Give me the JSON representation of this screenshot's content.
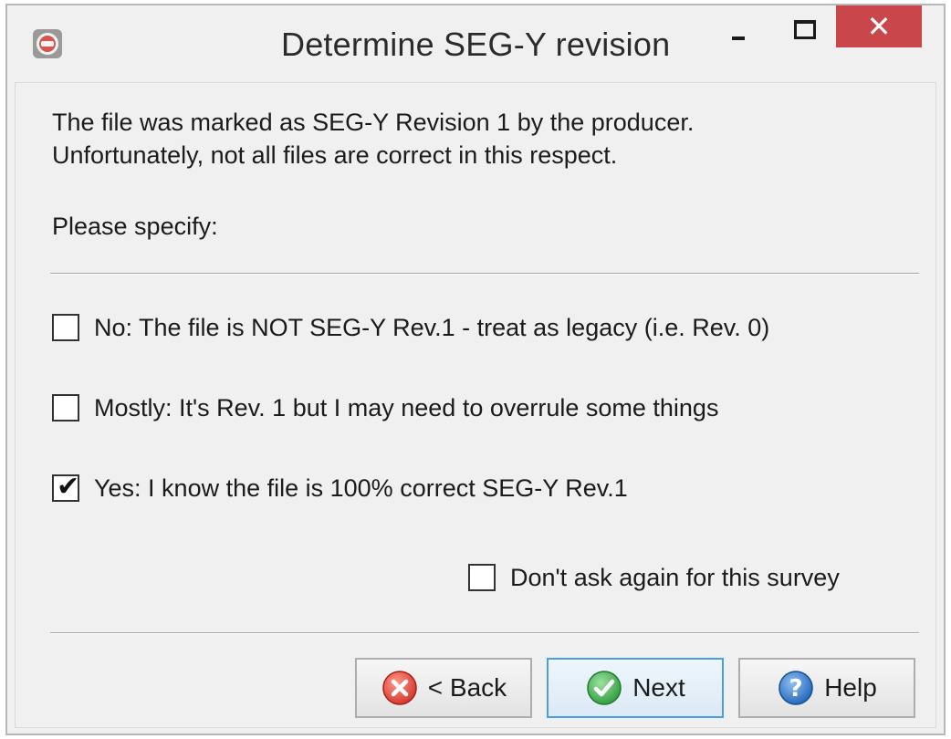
{
  "window": {
    "title": "Determine SEG-Y revision",
    "minimize_icon": "minimize-icon",
    "maximize_icon": "maximize-icon",
    "close_icon": "close-icon",
    "close_glyph": "✕",
    "close_color": "#c9474b"
  },
  "message": {
    "line1": "The file was marked as SEG-Y Revision 1 by the producer.",
    "line2": "Unfortunately, not all files are correct in this respect.",
    "prompt": "Please specify:"
  },
  "options": [
    {
      "label": "No: The file is NOT SEG-Y Rev.1 - treat as legacy (i.e. Rev. 0)",
      "checked": false
    },
    {
      "label": "Mostly: It's Rev. 1 but I may need to overrule some things",
      "checked": false
    },
    {
      "label": "Yes: I know the file is 100% correct SEG-Y Rev.1",
      "checked": true
    }
  ],
  "dont_ask": {
    "label": "Don't ask again for this survey",
    "checked": false
  },
  "buttons": {
    "back": {
      "label": "< Back",
      "icon": "cancel-x-icon",
      "color": "#e0453a"
    },
    "next": {
      "label": "Next",
      "icon": "checkmark-icon",
      "color": "#3fa84a"
    },
    "help": {
      "label": "Help",
      "icon": "help-question-icon",
      "color": "#2f7fd4"
    }
  },
  "check_glyph": "✔"
}
